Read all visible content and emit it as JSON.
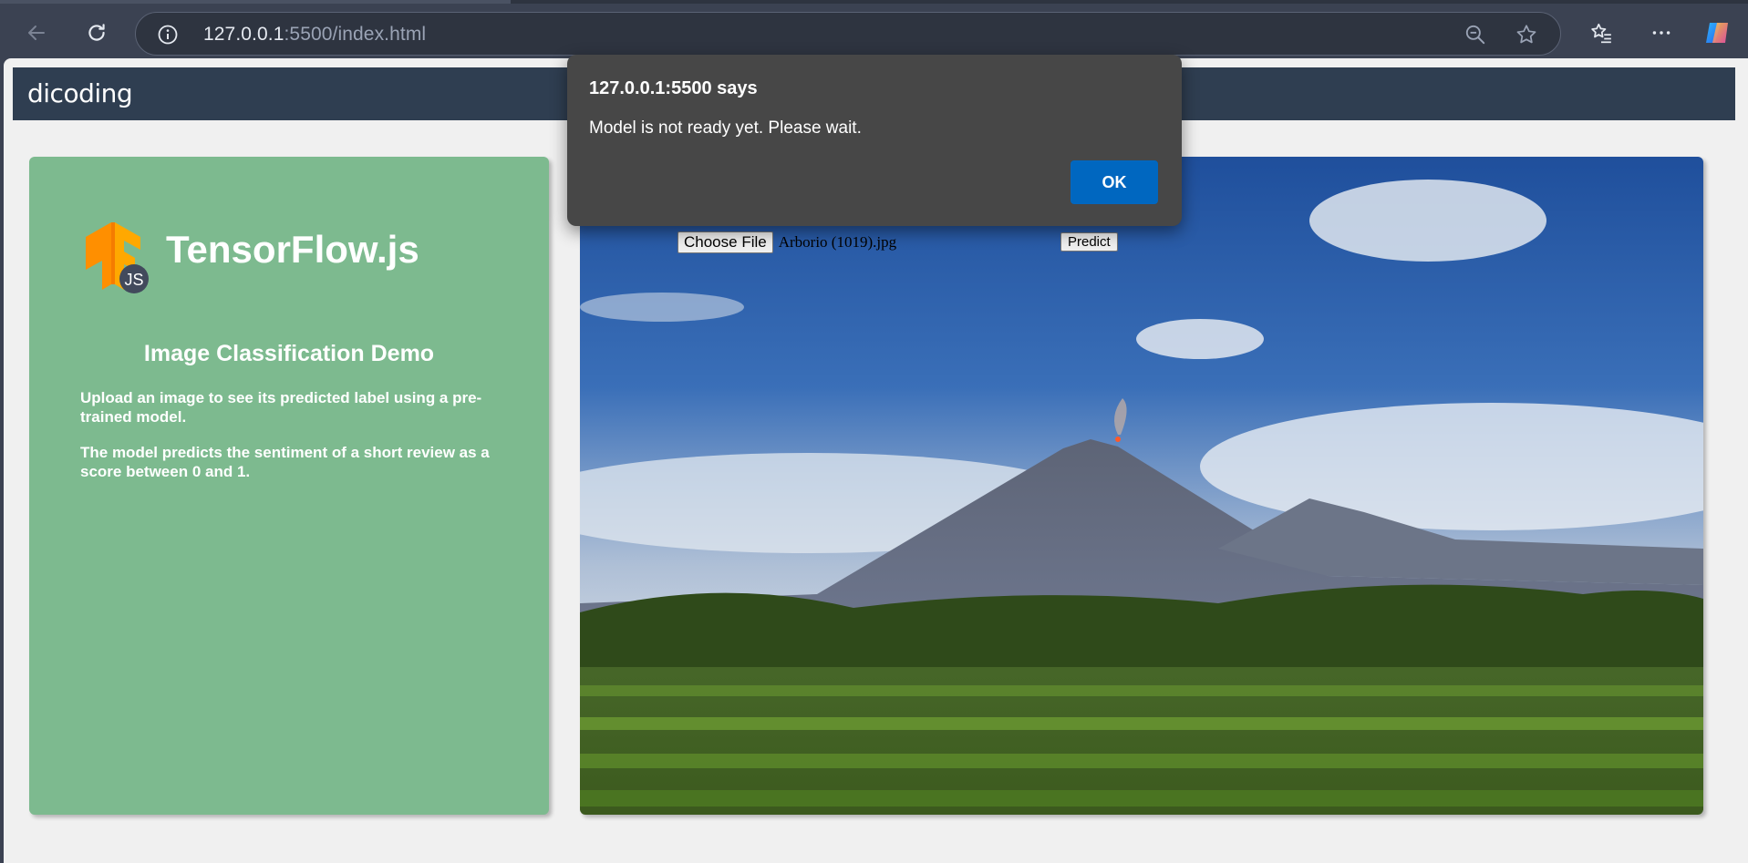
{
  "browser": {
    "url_host": "127.0.0.1",
    "url_rest": ":5500/index.html",
    "icons": [
      "back-arrow-icon",
      "reload-icon",
      "info-icon",
      "zoom-out-icon",
      "star-icon",
      "favorites-icon",
      "more-icon",
      "copilot-icon"
    ]
  },
  "navbar": {
    "logo": "dicoding"
  },
  "left_panel": {
    "logo_badge": "JS",
    "title": "TensorFlow.js",
    "demo_title": "Image Classification Demo",
    "desc1": "Upload an image to see its predicted label using a pre-trained model.",
    "desc2": "The model predicts the sentiment of a short review as a score between 0 and 1."
  },
  "form": {
    "choose_label": "Choose File",
    "file_name": "Arborio (1019).jpg",
    "predict_label": "Predict"
  },
  "dialog": {
    "title": "127.0.0.1:5500 says",
    "message": "Model is not ready yet. Please wait.",
    "ok_label": "OK"
  },
  "colors": {
    "navbar": "#2f3e51",
    "left_panel": "#7dba8f",
    "tf_orange": "#ff8f00",
    "dialog_bg": "#474747",
    "ok_button": "#0067c0"
  }
}
